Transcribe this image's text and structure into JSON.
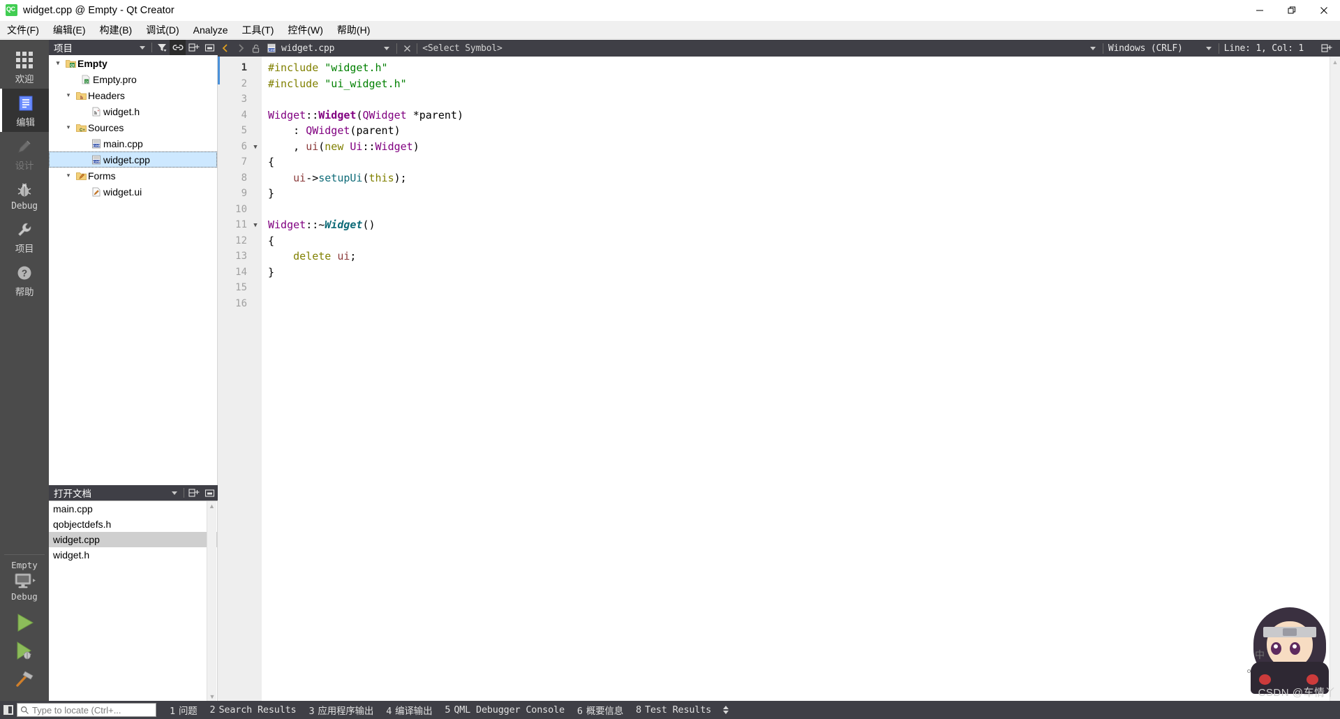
{
  "window": {
    "title": "widget.cpp @ Empty - Qt Creator",
    "app_icon": "qt-creator-logo-icon",
    "controls": {
      "minimize": "minimize-icon",
      "restore": "restore-icon",
      "close": "close-icon"
    }
  },
  "menubar": {
    "items": [
      {
        "label": "文件(F)"
      },
      {
        "label": "编辑(E)"
      },
      {
        "label": "构建(B)"
      },
      {
        "label": "调试(D)"
      },
      {
        "label": "Analyze"
      },
      {
        "label": "工具(T)"
      },
      {
        "label": "控件(W)"
      },
      {
        "label": "帮助(H)"
      }
    ]
  },
  "modebar": {
    "modes": [
      {
        "label": "欢迎",
        "icon": "grid-icon",
        "active": false,
        "disabled": false
      },
      {
        "label": "编辑",
        "icon": "document-lines-icon",
        "active": true,
        "disabled": false
      },
      {
        "label": "设计",
        "icon": "pencil-icon",
        "active": false,
        "disabled": true
      },
      {
        "label": "Debug",
        "icon": "bug-icon",
        "active": false,
        "disabled": false
      },
      {
        "label": "项目",
        "icon": "wrench-icon",
        "active": false,
        "disabled": false
      },
      {
        "label": "帮助",
        "icon": "question-circle-icon",
        "active": false,
        "disabled": false
      }
    ],
    "kit_selector": {
      "project": "Empty",
      "build_config": "Debug",
      "icon": "monitor-icon"
    },
    "actions": [
      {
        "name": "run",
        "icon": "play-triangle-icon"
      },
      {
        "name": "debug",
        "icon": "play-bug-icon"
      },
      {
        "name": "build",
        "icon": "hammer-icon"
      }
    ]
  },
  "project_panel": {
    "title": "项目",
    "tools": [
      {
        "name": "filter-dropdown",
        "icon": "chevron-down-icon",
        "active": false
      },
      {
        "name": "filter",
        "icon": "funnel-icon",
        "active": false
      },
      {
        "name": "sync-with-editor",
        "icon": "link-icon",
        "active": true
      },
      {
        "name": "split",
        "icon": "split-icon",
        "active": false
      },
      {
        "name": "collapse",
        "icon": "minimize-panel-icon",
        "active": false
      }
    ],
    "tree": [
      {
        "label": "Empty",
        "depth": 0,
        "arrow": "down",
        "icon": "qt-project-folder-icon",
        "bold": true,
        "selected": false
      },
      {
        "label": "Empty.pro",
        "depth": 1,
        "arrow": "",
        "icon": "qt-pro-file-icon",
        "bold": false,
        "selected": false
      },
      {
        "label": "Headers",
        "depth": 1,
        "arrow": "down",
        "icon": "headers-folder-icon",
        "bold": false,
        "selected": false
      },
      {
        "label": "widget.h",
        "depth": 2,
        "arrow": "",
        "icon": "h-file-icon",
        "bold": false,
        "selected": false
      },
      {
        "label": "Sources",
        "depth": 1,
        "arrow": "down",
        "icon": "sources-folder-icon",
        "bold": false,
        "selected": false
      },
      {
        "label": "main.cpp",
        "depth": 2,
        "arrow": "",
        "icon": "cpp-file-icon",
        "bold": false,
        "selected": false
      },
      {
        "label": "widget.cpp",
        "depth": 2,
        "arrow": "",
        "icon": "cpp-file-icon",
        "bold": false,
        "selected": true
      },
      {
        "label": "Forms",
        "depth": 1,
        "arrow": "down",
        "icon": "forms-folder-icon",
        "bold": false,
        "selected": false
      },
      {
        "label": "widget.ui",
        "depth": 2,
        "arrow": "",
        "icon": "ui-file-icon",
        "bold": false,
        "selected": false
      }
    ]
  },
  "open_documents": {
    "title": "打开文档",
    "tools": [
      {
        "name": "dropdown",
        "icon": "chevron-down-icon"
      },
      {
        "name": "split",
        "icon": "split-icon"
      },
      {
        "name": "collapse",
        "icon": "minimize-panel-icon"
      }
    ],
    "items": [
      {
        "label": "main.cpp",
        "selected": false
      },
      {
        "label": "qobjectdefs.h",
        "selected": false
      },
      {
        "label": "widget.cpp",
        "selected": true
      },
      {
        "label": "widget.h",
        "selected": false
      }
    ]
  },
  "editor_toolbar": {
    "back_icon": "chevron-left-icon",
    "forward_icon": "chevron-right-icon",
    "lock_icon": "unlocked-padlock-icon",
    "file_icon": "cpp-file-icon",
    "filename": "widget.cpp",
    "filename_dropdown_icon": "chevron-down-icon",
    "close_icon": "close-x-icon",
    "symbol_selector": "<Select Symbol>",
    "symbol_dropdown_icon": "chevron-down-icon",
    "line_ending": "Windows (CRLF)",
    "line_ending_dropdown_icon": "chevron-down-icon",
    "cursor_position": "Line: 1, Col: 1",
    "split_icon": "split-editor-icon"
  },
  "code": {
    "language": "C++",
    "current_line": 1,
    "lines": [
      {
        "n": 1,
        "fold": false,
        "tokens": [
          {
            "t": "#include ",
            "c": "k"
          },
          {
            "t": "\"widget.h\"",
            "c": "s"
          }
        ]
      },
      {
        "n": 2,
        "fold": false,
        "tokens": [
          {
            "t": "#include ",
            "c": "k"
          },
          {
            "t": "\"ui_widget.h\"",
            "c": "s"
          }
        ]
      },
      {
        "n": 3,
        "fold": false,
        "tokens": []
      },
      {
        "n": 4,
        "fold": false,
        "tokens": [
          {
            "t": "Widget",
            "c": "ty"
          },
          {
            "t": "::",
            "c": "p"
          },
          {
            "t": "Widget",
            "c": "tb"
          },
          {
            "t": "(",
            "c": "p"
          },
          {
            "t": "QWidget",
            "c": "ty"
          },
          {
            "t": " *",
            "c": "p"
          },
          {
            "t": "parent",
            "c": "pa"
          },
          {
            "t": ")",
            "c": "p"
          }
        ]
      },
      {
        "n": 5,
        "fold": false,
        "tokens": [
          {
            "t": "    : ",
            "c": "p"
          },
          {
            "t": "QWidget",
            "c": "ty"
          },
          {
            "t": "(",
            "c": "p"
          },
          {
            "t": "parent",
            "c": "pa"
          },
          {
            "t": ")",
            "c": "p"
          }
        ]
      },
      {
        "n": 6,
        "fold": true,
        "tokens": [
          {
            "t": "    , ",
            "c": "p"
          },
          {
            "t": "ui",
            "c": "v"
          },
          {
            "t": "(",
            "c": "p"
          },
          {
            "t": "new",
            "c": "k"
          },
          {
            "t": " ",
            "c": "p"
          },
          {
            "t": "Ui",
            "c": "ty"
          },
          {
            "t": "::",
            "c": "p"
          },
          {
            "t": "Widget",
            "c": "ty"
          },
          {
            "t": ")",
            "c": "p"
          }
        ]
      },
      {
        "n": 7,
        "fold": false,
        "tokens": [
          {
            "t": "{",
            "c": "p"
          }
        ]
      },
      {
        "n": 8,
        "fold": false,
        "tokens": [
          {
            "t": "    ",
            "c": "p"
          },
          {
            "t": "ui",
            "c": "v"
          },
          {
            "t": "->",
            "c": "p"
          },
          {
            "t": "setupUi",
            "c": "fn"
          },
          {
            "t": "(",
            "c": "p"
          },
          {
            "t": "this",
            "c": "k"
          },
          {
            "t": ");",
            "c": "p"
          }
        ]
      },
      {
        "n": 9,
        "fold": false,
        "tokens": [
          {
            "t": "}",
            "c": "p"
          }
        ]
      },
      {
        "n": 10,
        "fold": false,
        "tokens": []
      },
      {
        "n": 11,
        "fold": true,
        "tokens": [
          {
            "t": "Widget",
            "c": "ty"
          },
          {
            "t": "::~",
            "c": "p"
          },
          {
            "t": "Widget",
            "c": "fb"
          },
          {
            "t": "()",
            "c": "p"
          }
        ]
      },
      {
        "n": 12,
        "fold": false,
        "tokens": [
          {
            "t": "{",
            "c": "p"
          }
        ]
      },
      {
        "n": 13,
        "fold": false,
        "tokens": [
          {
            "t": "    ",
            "c": "p"
          },
          {
            "t": "delete",
            "c": "k"
          },
          {
            "t": " ",
            "c": "p"
          },
          {
            "t": "ui",
            "c": "v"
          },
          {
            "t": ";",
            "c": "p"
          }
        ]
      },
      {
        "n": 14,
        "fold": false,
        "tokens": [
          {
            "t": "}",
            "c": "p"
          }
        ]
      },
      {
        "n": 15,
        "fold": false,
        "tokens": []
      },
      {
        "n": 16,
        "fold": false,
        "tokens": []
      }
    ]
  },
  "statusbar": {
    "sidebar_toggle_icon": "toggle-sidebar-icon",
    "locator_placeholder": "Type to locate (Ctrl+...",
    "locator_value": "",
    "locator_icon": "search-icon",
    "tabs": [
      {
        "num": "1",
        "label": "问题"
      },
      {
        "num": "2",
        "label": "Search Results"
      },
      {
        "num": "3",
        "label": "应用程序输出"
      },
      {
        "num": "4",
        "label": "编译输出"
      },
      {
        "num": "5",
        "label": "QML Debugger Console"
      },
      {
        "num": "6",
        "label": "概要信息"
      },
      {
        "num": "8",
        "label": "Test Results"
      }
    ],
    "updown_icon": "up-down-arrows-icon"
  },
  "watermark": {
    "text": "CSDN @车情丫",
    "ime_indicator": "中"
  },
  "colors": {
    "accent_green": "#41cd52",
    "dark_chrome": "#3f3f46",
    "modebar": "#4b4b4b",
    "selection_blue": "#cde8ff",
    "keyword": "#808000",
    "string": "#008000",
    "type": "#800080",
    "function": "#0e6b78",
    "member": "#8b3a3a"
  }
}
